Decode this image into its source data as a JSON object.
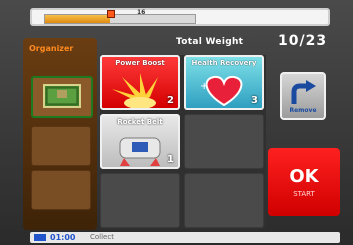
{
  "header": {
    "total_weight_label": "Total Weight",
    "total_weight_value": "10/23",
    "weight_bar_max_label": "16",
    "weight_fill_fraction": 0.43
  },
  "organizer": {
    "title": "Organizer",
    "slots": [
      {
        "icon": "field-stage-icon",
        "label": ""
      },
      {
        "icon": "",
        "label": ""
      },
      {
        "icon": "",
        "label": ""
      }
    ]
  },
  "powers": [
    {
      "name": "Power Boost",
      "level": "2",
      "color": "#e80000"
    },
    {
      "name": "Health Recovery",
      "level": "3",
      "color": "#3ab4d0"
    },
    {
      "name": "Rocket Belt",
      "level": "1",
      "color": "#c8c8c8"
    }
  ],
  "buttons": {
    "remove_label": "Remove",
    "ok_label": "OK",
    "ok_sub": "START"
  },
  "status": {
    "time": "01:00",
    "aux": "Collect"
  },
  "colors": {
    "accent_red": "#e00000",
    "organizer_brown": "#5a3414",
    "weight_orange": "#f0a020"
  }
}
